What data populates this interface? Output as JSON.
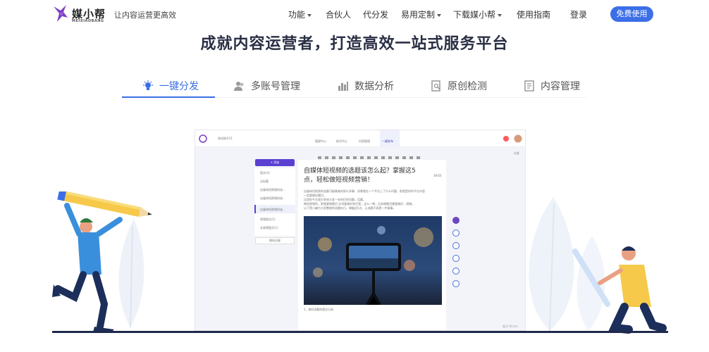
{
  "nav": {
    "brand": "媒小帮",
    "brand_sub": "MEIXIAOBANG",
    "slogan": "让内容运营更高效",
    "items": [
      {
        "label": "功能",
        "dropdown": true
      },
      {
        "label": "合伙人",
        "dropdown": false
      },
      {
        "label": "代分发",
        "dropdown": false
      },
      {
        "label": "易用定制",
        "dropdown": true
      },
      {
        "label": "下载媒小帮",
        "dropdown": true
      },
      {
        "label": "使用指南",
        "dropdown": false
      },
      {
        "label": "登录",
        "dropdown": false
      }
    ],
    "cta": "免费使用"
  },
  "hero": {
    "title": "成就内容运营者，打造高效一站式服务平台"
  },
  "tabs": [
    {
      "label": "一键分发",
      "icon": "lightbulb-icon",
      "active": true
    },
    {
      "label": "多账号管理",
      "icon": "users-icon",
      "active": false
    },
    {
      "label": "数据分析",
      "icon": "bar-chart-icon",
      "active": false
    },
    {
      "label": "原创检测",
      "icon": "search-document-icon",
      "active": false
    },
    {
      "label": "内容管理",
      "icon": "document-icon",
      "active": false
    }
  ],
  "app": {
    "account": "测试账号11",
    "top_tabs": [
      "管理中心",
      "账号中心",
      "内容管理",
      "一键发布"
    ],
    "side_label": "分发",
    "add_button": "+ 添加",
    "left_items": [
      "图文(4)",
      "无标题",
      "自媒体短视频的选...",
      "自媒体短视频的选...",
      "自媒体短视频的选..."
    ],
    "left_groups": [
      "视频图文(1)",
      "长视频图文(1)"
    ],
    "left_footer": "保存记录",
    "doc_title": "自媒体短视频的选题该怎么起？掌握这5点，轻松做短视频营销！",
    "char_count": "39/50",
    "body_lines": [
      "自媒体短视频的选题可能最难的那么多事，如果就在一个平台上了什么问题，那就是你的平台内容",
      "一定要做好题目，",
      "比如你今天就分享给大家一些你们的问题，话题。",
      "做短视频的，那就要做题目 必须要做好你们是，这么一期，比如做题目都要做好，就做。",
      "以下是小编为大家整理的选题技巧，掌握这5点，让选题不再是一件难事。"
    ],
    "caption": "1、做好选题的图文分析",
    "watermark": "激活 Windo"
  }
}
